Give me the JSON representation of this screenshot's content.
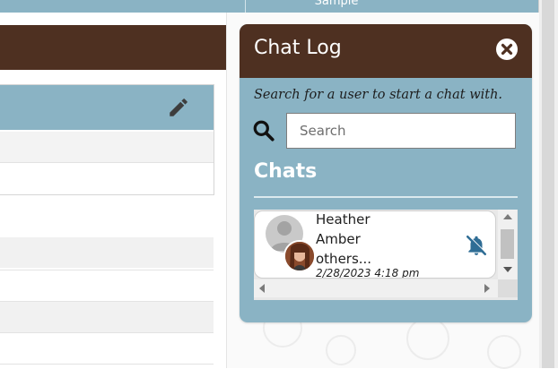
{
  "header": {
    "column_label": "Sample"
  },
  "chat_panel": {
    "title": "Chat Log",
    "close_icon": "close-circle-icon",
    "hint": "Search for a user to start a chat with.",
    "search": {
      "placeholder": "Search",
      "value": "",
      "icon": "search-icon"
    },
    "chats_heading": "Chats",
    "chats": [
      {
        "names": [
          "Heather",
          "Amber",
          "others..."
        ],
        "timestamp": "2/28/2023 4:18 pm",
        "status_icon": "bell-muted-icon"
      }
    ]
  },
  "colors": {
    "brand_brown": "#4e3021",
    "panel_blue": "#8ab3c4",
    "mute_icon_blue": "#2f6d95"
  }
}
